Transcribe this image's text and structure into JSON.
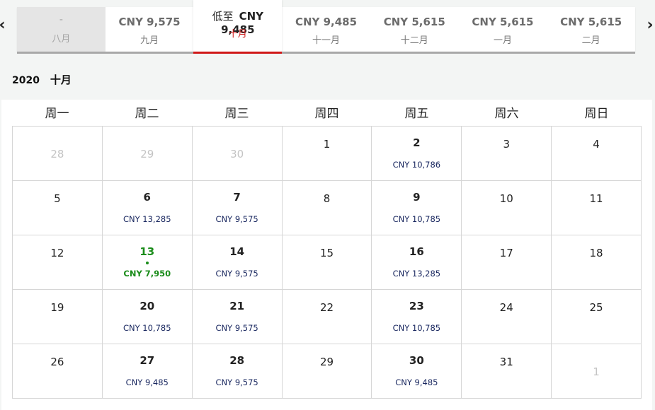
{
  "nav": {
    "prev_icon": "chevron-left-icon",
    "next_icon": "chevron-right-icon",
    "prev_glyph": "‹",
    "next_glyph": "›"
  },
  "months": [
    {
      "price": "-",
      "label": "八月",
      "state": "disabled"
    },
    {
      "price": "CNY 9,575",
      "label": "九月",
      "state": "normal"
    },
    {
      "price": "CNY 9,485",
      "label": "十月",
      "state": "active",
      "prefix": "低至"
    },
    {
      "price": "CNY 9,485",
      "label": "十一月",
      "state": "normal"
    },
    {
      "price": "CNY 5,615",
      "label": "十二月",
      "state": "normal"
    },
    {
      "price": "CNY 5,615",
      "label": "一月",
      "state": "normal"
    },
    {
      "price": "CNY 5,615",
      "label": "二月",
      "state": "normal"
    }
  ],
  "calendar": {
    "year": "2020",
    "month": "十月",
    "weekdays": [
      "周一",
      "周二",
      "周三",
      "周四",
      "周五",
      "周六",
      "周日"
    ],
    "colors": {
      "lowest": "#1a8c1a",
      "price": "#1a2860",
      "active_tab": "#d01818"
    },
    "days": [
      {
        "d": "28",
        "other": true
      },
      {
        "d": "29",
        "other": true
      },
      {
        "d": "30",
        "other": true
      },
      {
        "d": "1"
      },
      {
        "d": "2",
        "price": "CNY 10,786"
      },
      {
        "d": "3"
      },
      {
        "d": "4"
      },
      {
        "d": "5"
      },
      {
        "d": "6",
        "price": "CNY 13,285"
      },
      {
        "d": "7",
        "price": "CNY 9,575"
      },
      {
        "d": "8"
      },
      {
        "d": "9",
        "price": "CNY 10,785"
      },
      {
        "d": "10"
      },
      {
        "d": "11"
      },
      {
        "d": "12"
      },
      {
        "d": "13",
        "price": "CNY 7,950",
        "lowest": true
      },
      {
        "d": "14",
        "price": "CNY 9,575"
      },
      {
        "d": "15"
      },
      {
        "d": "16",
        "price": "CNY 13,285"
      },
      {
        "d": "17"
      },
      {
        "d": "18"
      },
      {
        "d": "19"
      },
      {
        "d": "20",
        "price": "CNY 10,785"
      },
      {
        "d": "21",
        "price": "CNY 9,575"
      },
      {
        "d": "22"
      },
      {
        "d": "23",
        "price": "CNY 10,785"
      },
      {
        "d": "24"
      },
      {
        "d": "25"
      },
      {
        "d": "26"
      },
      {
        "d": "27",
        "price": "CNY 9,485"
      },
      {
        "d": "28",
        "price": "CNY 9,575"
      },
      {
        "d": "29"
      },
      {
        "d": "30",
        "price": "CNY 9,485"
      },
      {
        "d": "31"
      },
      {
        "d": "1",
        "other": true
      }
    ]
  }
}
